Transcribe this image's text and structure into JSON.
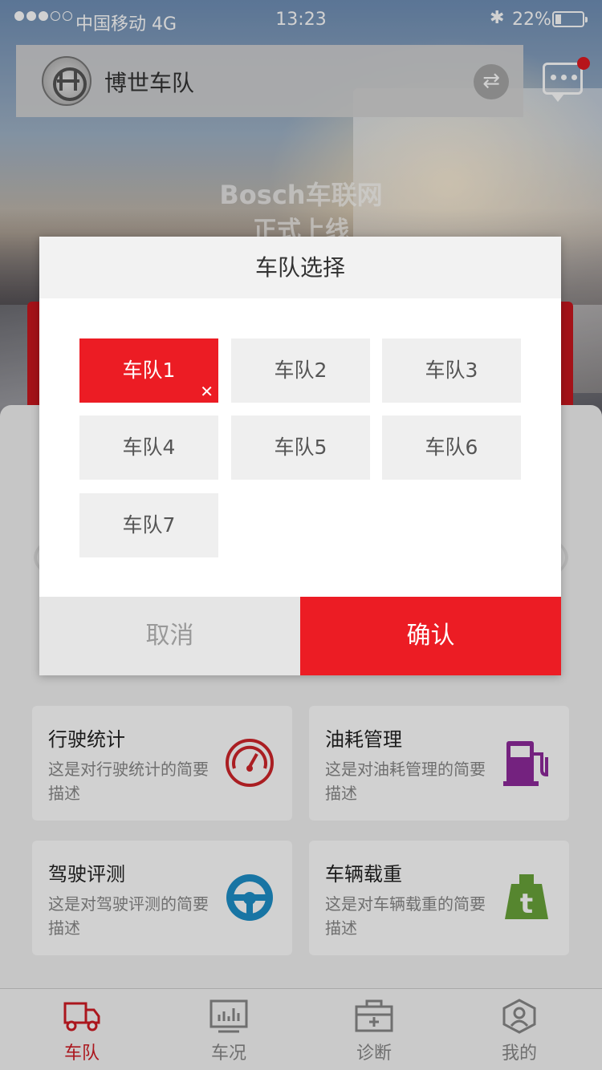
{
  "status_bar": {
    "carrier": "中国移动 4G",
    "time": "13:23",
    "battery": "22%"
  },
  "header": {
    "fleet_name": "博世车队"
  },
  "banner": {
    "line1": "Bosch车联网",
    "line2": "正式上线"
  },
  "dialog": {
    "title": "车队选择",
    "options": [
      {
        "label": "车队1",
        "selected": true
      },
      {
        "label": "车队2",
        "selected": false
      },
      {
        "label": "车队3",
        "selected": false
      },
      {
        "label": "车队4",
        "selected": false
      },
      {
        "label": "车队5",
        "selected": false
      },
      {
        "label": "车队6",
        "selected": false
      },
      {
        "label": "车队7",
        "selected": false
      }
    ],
    "cancel_label": "取消",
    "confirm_label": "确认"
  },
  "cards": [
    {
      "title": "行驶统计",
      "desc": "这是对行驶统计的简要描述",
      "icon": "speedometer-icon",
      "color": "#d0252a"
    },
    {
      "title": "油耗管理",
      "desc": "这是对油耗管理的简要描述",
      "icon": "fuel-pump-icon",
      "color": "#8e2a9c"
    },
    {
      "title": "驾驶评测",
      "desc": "这是对驾驶评测的简要描述",
      "icon": "steering-wheel-icon",
      "color": "#1e8fc8"
    },
    {
      "title": "车辆载重",
      "desc": "这是对车辆载重的简要描述",
      "icon": "weight-icon",
      "color": "#6aa43a"
    }
  ],
  "tabs": [
    {
      "label": "车队",
      "icon": "truck-icon",
      "active": true
    },
    {
      "label": "车况",
      "icon": "monitor-icon",
      "active": false
    },
    {
      "label": "诊断",
      "icon": "toolbox-icon",
      "active": false
    },
    {
      "label": "我的",
      "icon": "user-hexagon-icon",
      "active": false
    }
  ],
  "colors": {
    "accent": "#ec1c24",
    "muted": "#999999"
  }
}
